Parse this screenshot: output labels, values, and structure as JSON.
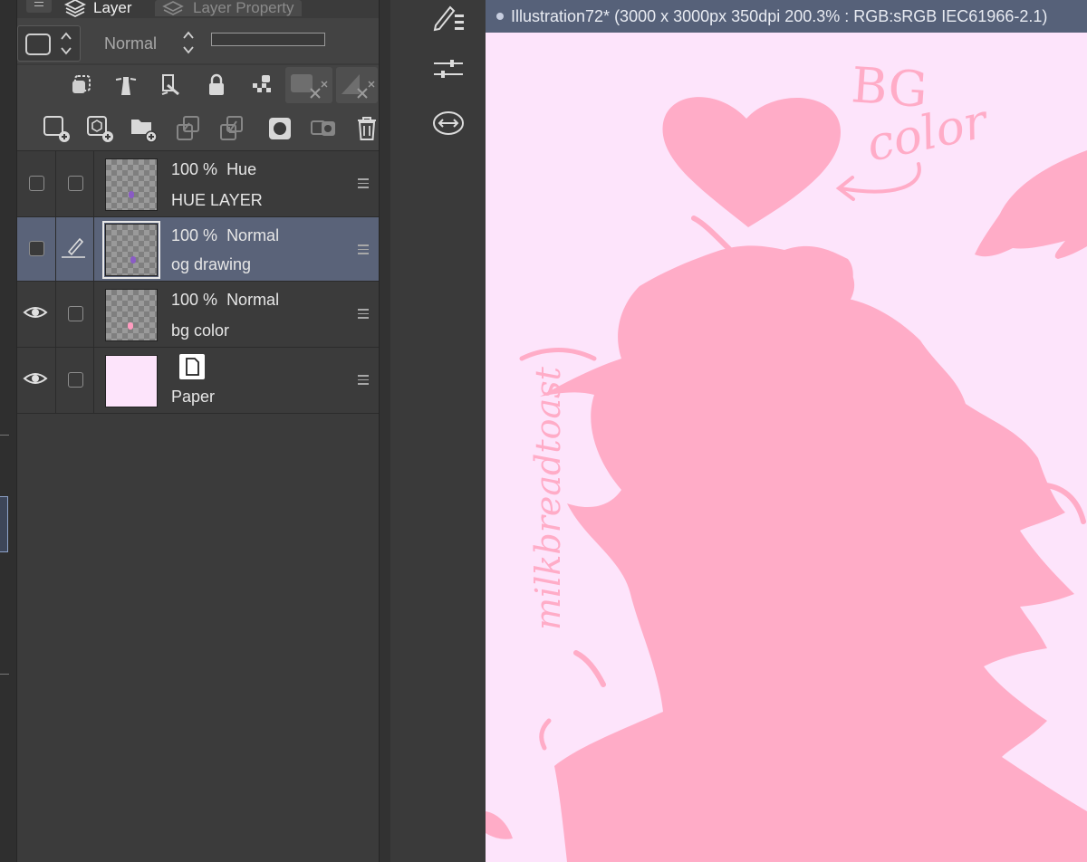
{
  "panel": {
    "tabs": [
      {
        "label": "Layer",
        "icon": "layers-icon"
      },
      {
        "label": "Layer Property",
        "icon": "layer-property-icon"
      }
    ],
    "blend_mode": "Normal"
  },
  "layers": [
    {
      "opacity": "100 %",
      "mode": "Hue",
      "name": "HUE LAYER",
      "visible": false,
      "selected": false
    },
    {
      "opacity": "100 %",
      "mode": "Normal",
      "name": "og drawing",
      "visible": false,
      "selected": true,
      "editing": true
    },
    {
      "opacity": "100 %",
      "mode": "Normal",
      "name": "bg color",
      "visible": true,
      "selected": false
    },
    {
      "name": "Paper",
      "visible": true,
      "selected": false,
      "paper": true
    }
  ],
  "canvas": {
    "title": "Illustration72* (3000 x 3000px 350dpi 200.3% : RGB:sRGB IEC61966-2.1)",
    "background_color": "#fde4fb",
    "art_color": "#ffacc7",
    "annotation": [
      "BG",
      "color"
    ],
    "signature": "milkbreadtoast"
  },
  "colors": {
    "panel_bg": "#3b3b3b",
    "selected_row": "#5a6379",
    "title_bar": "#566179"
  }
}
